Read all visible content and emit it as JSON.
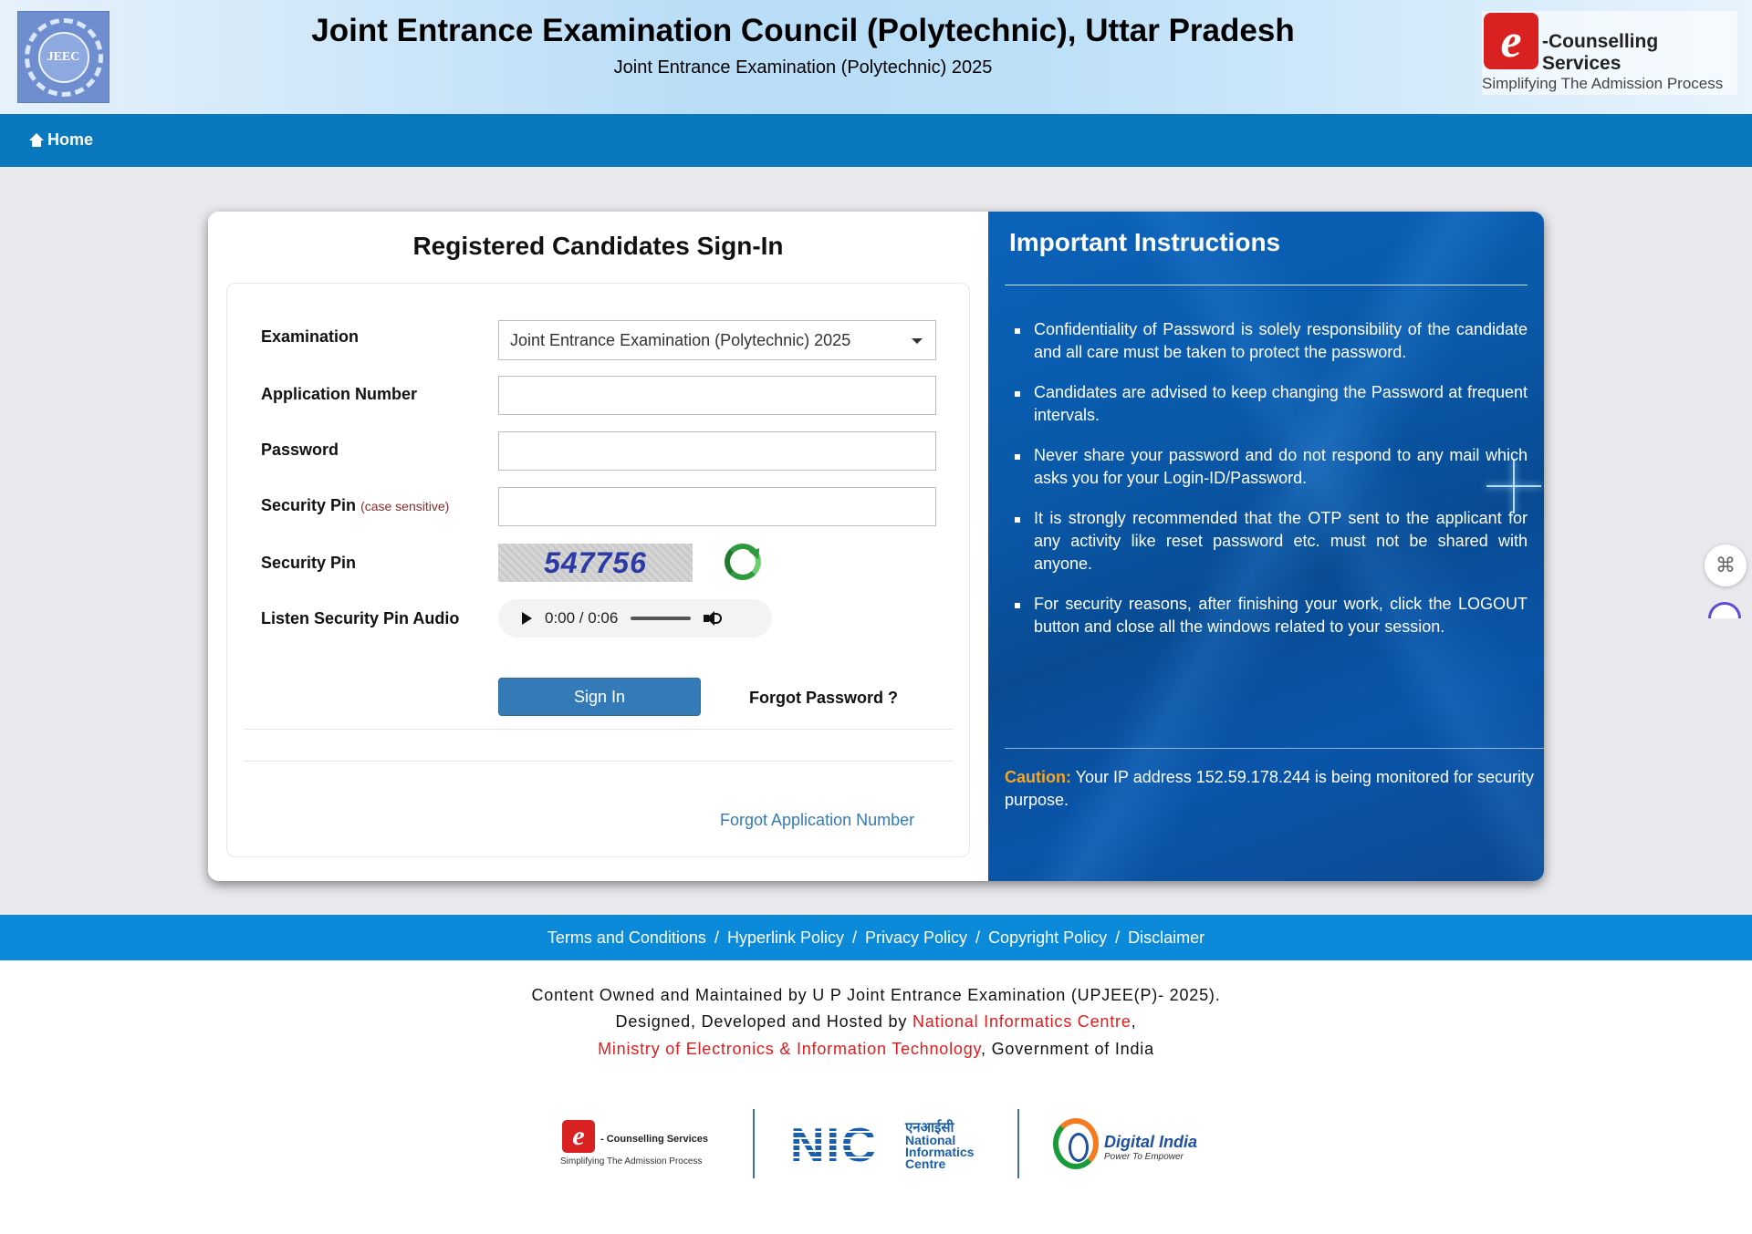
{
  "header": {
    "title": "Joint Entrance Examination Council (Polytechnic), Uttar Pradesh",
    "subtitle": "Joint Entrance Examination (Polytechnic) 2025",
    "left_logo_text": "JEEC",
    "ec_logo": {
      "letter": "e",
      "name": "-Counselling Services",
      "tagline": "Simplifying The Admission Process"
    }
  },
  "nav": {
    "home_label": "Home"
  },
  "signin": {
    "title": "Registered Candidates Sign-In",
    "examination_label": "Examination",
    "examination_value": "Joint Entrance Examination (Polytechnic) 2025",
    "application_label": "Application Number",
    "application_value": "",
    "password_label": "Password",
    "password_value": "",
    "security_pin_input_label": "Security Pin",
    "case_sensitive_note": "(case sensitive)",
    "security_pin_input_value": "",
    "security_pin_label": "Security Pin",
    "captcha_text": "547756",
    "audio_label": "Listen Security Pin Audio",
    "audio_time": "0:00 / 0:06",
    "signin_button": "Sign In",
    "forgot_password": "Forgot Password ?",
    "forgot_application": "Forgot Application Number"
  },
  "instructions": {
    "title": "Important Instructions",
    "items": [
      "Confidentiality of Password is solely responsibility of the candidate and all care must be taken to protect the password.",
      "Candidates are advised to keep changing the Password at frequent intervals.",
      "Never share your password and do not respond to any mail which asks you for your Login-ID/Password.",
      "It is strongly recommended that the OTP sent to the applicant for any activity like reset password etc. must not be shared with anyone.",
      "For security reasons, after finishing your work, click the LOGOUT button and close all the windows related to your session."
    ],
    "caution_label": "Caution:",
    "caution_text": "Your IP address 152.59.178.244 is being monitored for security purpose."
  },
  "footer": {
    "links": [
      "Terms and Conditions",
      "Hyperlink Policy",
      "Privacy Policy",
      "Copyright Policy",
      "Disclaimer"
    ],
    "separator": "/",
    "line1": "Content Owned and Maintained by U P Joint Entrance Examination (UPJEE(P)- 2025).",
    "line2_prefix": "Designed, Developed and Hosted by ",
    "line2_link": "National Informatics Centre",
    "line2_suffix": ",",
    "line3_link": "Ministry of Electronics & Information Technology",
    "line3_suffix": ", Government of India",
    "logos": {
      "ec_name": "- Counselling Services",
      "ec_tagline": "Simplifying The Admission Process",
      "nic": "NIC",
      "nic_hindi": "एनआईसी",
      "nic_name": [
        "National",
        "Informatics",
        "Centre"
      ],
      "di_name": "Digital India",
      "di_tagline": "Power To Empower"
    }
  },
  "colors": {
    "nav": "#0a78be",
    "footer_bar": "#0a8ad8",
    "accent_link": "#337ab7",
    "caution": "#f5a623",
    "red_link": "#e31a1a"
  }
}
